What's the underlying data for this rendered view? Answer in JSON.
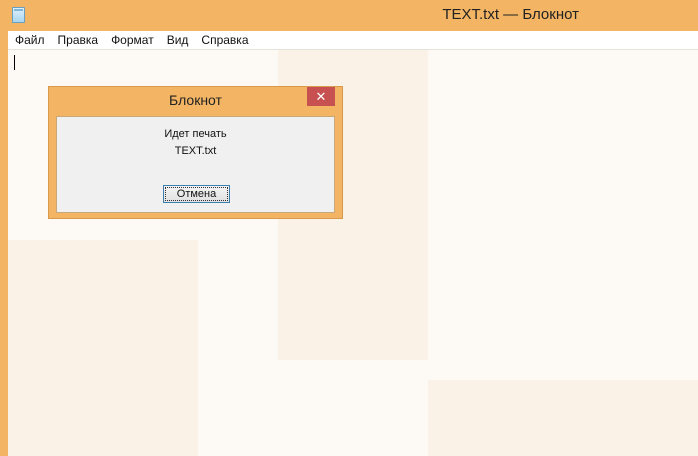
{
  "window": {
    "title": "TEXT.txt — Блокнот",
    "icon": "notepad-icon"
  },
  "menu": {
    "items": [
      "Файл",
      "Правка",
      "Формат",
      "Вид",
      "Справка"
    ]
  },
  "dialog": {
    "title": "Блокнот",
    "close_glyph": "✕",
    "message_line1": "Идет печать",
    "message_line2": "TEXT.txt",
    "cancel_label": "Отмена"
  },
  "colors": {
    "accent": "#f3b564",
    "close_button": "#c75050",
    "editor_background": "#fdfaf6"
  }
}
